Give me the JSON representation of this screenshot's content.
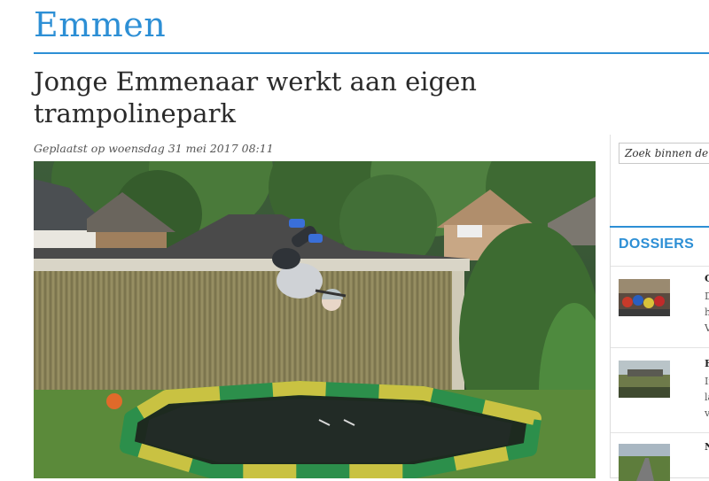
{
  "section": {
    "title": "Emmen"
  },
  "article": {
    "headline": "Jonge Emmenaar werkt aan eigen trampolinepark",
    "meta": "Geplaatst op woensdag 31 mei 2017 08:11"
  },
  "sidebar": {
    "search_placeholder": "Zoek binnen de s",
    "dossiers_title": "DOSSIERS",
    "items": [
      {
        "title_char": "C",
        "line1": "D",
        "line2": "h",
        "line3": "V"
      },
      {
        "title_char": "F",
        "line1": "Ir",
        "line2": "la",
        "line3": "v"
      },
      {
        "title_char": "N",
        "line1": "",
        "line2": "",
        "line3": ""
      }
    ]
  },
  "colors": {
    "accent": "#2d8fd5",
    "text": "#2a2a2a"
  }
}
